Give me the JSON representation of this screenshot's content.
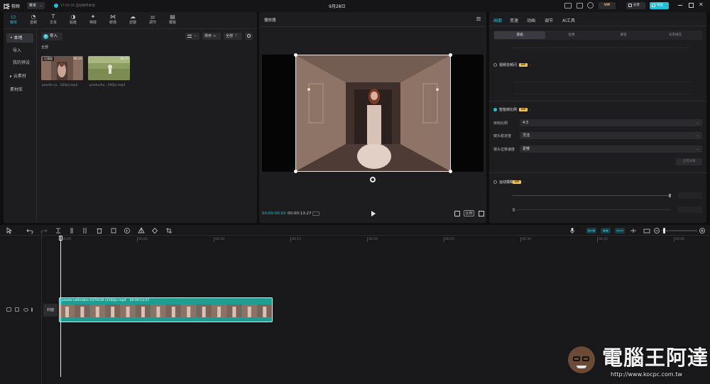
{
  "app": {
    "logo": "剪映",
    "menu": "菜单",
    "save_status": "17:02:35 自动保存本地",
    "project_title": "9月28日",
    "pro_badge": "VIP",
    "share_label": "分享",
    "export_label": "导出"
  },
  "media_tabs": [
    {
      "label": "媒体",
      "icon": "media-icon"
    },
    {
      "label": "音频",
      "icon": "audio-icon"
    },
    {
      "label": "文本",
      "icon": "text-icon"
    },
    {
      "label": "贴纸",
      "icon": "sticker-icon"
    },
    {
      "label": "特效",
      "icon": "effects-icon"
    },
    {
      "label": "转场",
      "icon": "transition-icon"
    },
    {
      "label": "滤镜",
      "icon": "filter-icon"
    },
    {
      "label": "调节",
      "icon": "adjust-icon"
    },
    {
      "label": "模板",
      "icon": "template-icon"
    }
  ],
  "sidebar": {
    "items": [
      {
        "label": "• 本地"
      },
      {
        "label": "导入"
      },
      {
        "label": "我的预设"
      },
      {
        "label": "▸ 云素材"
      },
      {
        "label": "素材库"
      }
    ]
  },
  "media": {
    "import_label": "导入",
    "section_all": "全部",
    "sort_label": "排序",
    "filter_label": "全部",
    "items": [
      {
        "badge": "已添加",
        "duration": "00:14",
        "name": "pexels-co...160p).mp4"
      },
      {
        "badge": "",
        "duration": "00:15",
        "name": "productio...160p).mp4"
      }
    ]
  },
  "player": {
    "title": "播放器",
    "current_time": "00:00:00:03",
    "total_time": "00:00:13:27",
    "ratio_label": "比例"
  },
  "props": {
    "tabs": [
      "画面",
      "变速",
      "动画",
      "调节",
      "AI工具"
    ],
    "segments": [
      "基础",
      "抠像",
      "蒙版",
      "背景填充"
    ],
    "video_denoise": "视频去频闪",
    "smart_ratio": "智能转比例",
    "target_ratio_label": "目标比例",
    "target_ratio_value": "4:3",
    "stabilize_label": "镜头稳定度",
    "stabilize_value": "灵活",
    "motion_label": "镜头位移速度",
    "motion_value": "更慢",
    "apply_button": "应用效果",
    "motion_blur": "运动模糊",
    "vip_tag": "VIP"
  },
  "timeline": {
    "ruler": [
      "00:00",
      "00:05",
      "00:10",
      "00:15",
      "00:20",
      "00:25",
      "00:30",
      "00:35",
      "00:40"
    ],
    "track_cover": "封面",
    "clip_name": "pexels-cottonbro-5379136 (2160p).mp4",
    "clip_duration": "00:00:13:27"
  },
  "watermark": {
    "brand": "電腦王阿達",
    "url": "http://www.kocpc.com.tw"
  },
  "colors": {
    "accent": "#22c0d8",
    "clip": "#1f9d93",
    "vip": "#f0c35b"
  }
}
